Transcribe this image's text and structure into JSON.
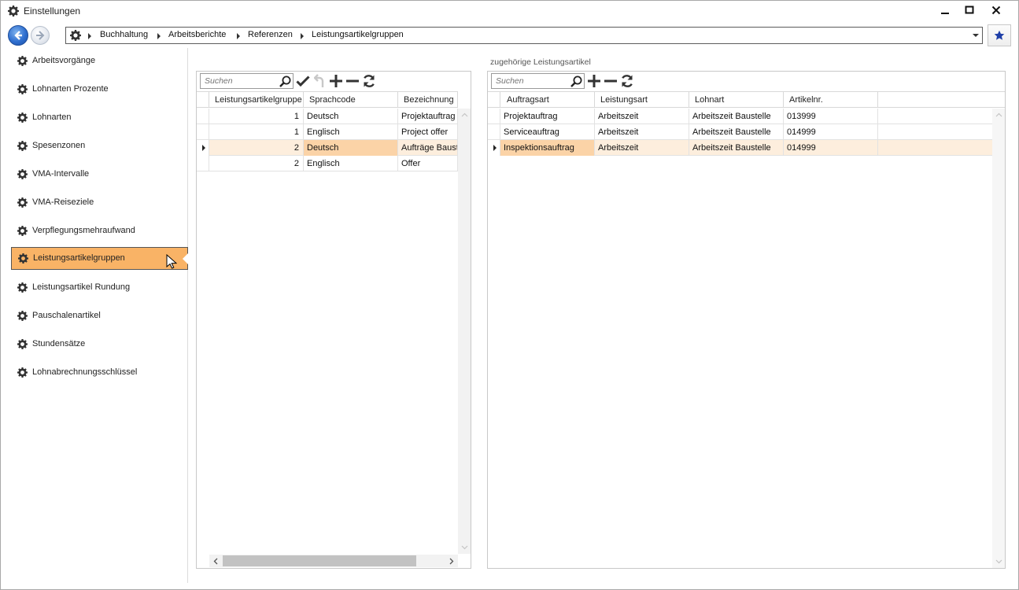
{
  "window": {
    "title": "Einstellungen",
    "controls": [
      "minimize-icon",
      "maximize-icon",
      "close-icon"
    ]
  },
  "address_bar": {
    "breadcrumbs": [
      "Buchhaltung",
      "Arbeitsberichte",
      "Referenzen",
      "Leistungsartikelgruppen"
    ]
  },
  "sidebar": {
    "items": [
      {
        "label": "Arbeitsvorgänge"
      },
      {
        "label": "Lohnarten Prozente"
      },
      {
        "label": "Lohnarten"
      },
      {
        "label": "Spesenzonen"
      },
      {
        "label": "VMA-Intervalle"
      },
      {
        "label": "VMA-Reiseziele"
      },
      {
        "label": "Verpflegungsmehraufwand"
      },
      {
        "label": "Leistungsartikelgruppen"
      },
      {
        "label": "Leistungsartikel Rundung"
      },
      {
        "label": "Pauschalenartikel"
      },
      {
        "label": "Stundensätze"
      },
      {
        "label": "Lohnabrechnungsschlüssel"
      }
    ],
    "active_index": 7
  },
  "left_grid": {
    "search_placeholder": "Suchen",
    "columns": [
      "Leistungsartikelgruppe",
      "Sprachcode",
      "Bezeichnung"
    ],
    "rows": [
      {
        "group": "1",
        "lang": "Deutsch",
        "name": "Projektauftrag"
      },
      {
        "group": "1",
        "lang": "Englisch",
        "name": "Project offer"
      },
      {
        "group": "2",
        "lang": "Deutsch",
        "name": "Aufträge Baustelle"
      },
      {
        "group": "2",
        "lang": "Englisch",
        "name": "Offer"
      }
    ],
    "selected_row": 2
  },
  "right_grid": {
    "section_label": "zugehörige Leistungsartikel",
    "search_placeholder": "Suchen",
    "columns": [
      "Auftragsart",
      "Leistungsart",
      "Lohnart",
      "Artikelnr."
    ],
    "rows": [
      {
        "order_type": "Projektauftrag",
        "service_type": "Arbeitszeit",
        "wage_type": "Arbeitszeit Baustelle",
        "article_no": "013999"
      },
      {
        "order_type": "Serviceauftrag",
        "service_type": "Arbeitszeit",
        "wage_type": "Arbeitszeit Baustelle",
        "article_no": "014999"
      },
      {
        "order_type": "Inspektionsauftrag",
        "service_type": "Arbeitszeit",
        "wage_type": "Arbeitszeit Baustelle",
        "article_no": "014999"
      }
    ],
    "selected_row": 2
  },
  "colors": {
    "sidebar_active": "#f9b366",
    "row_selected": "#fdeedd",
    "cell_focus": "#fbd3a7",
    "favorite_star": "#1f3fa8"
  }
}
